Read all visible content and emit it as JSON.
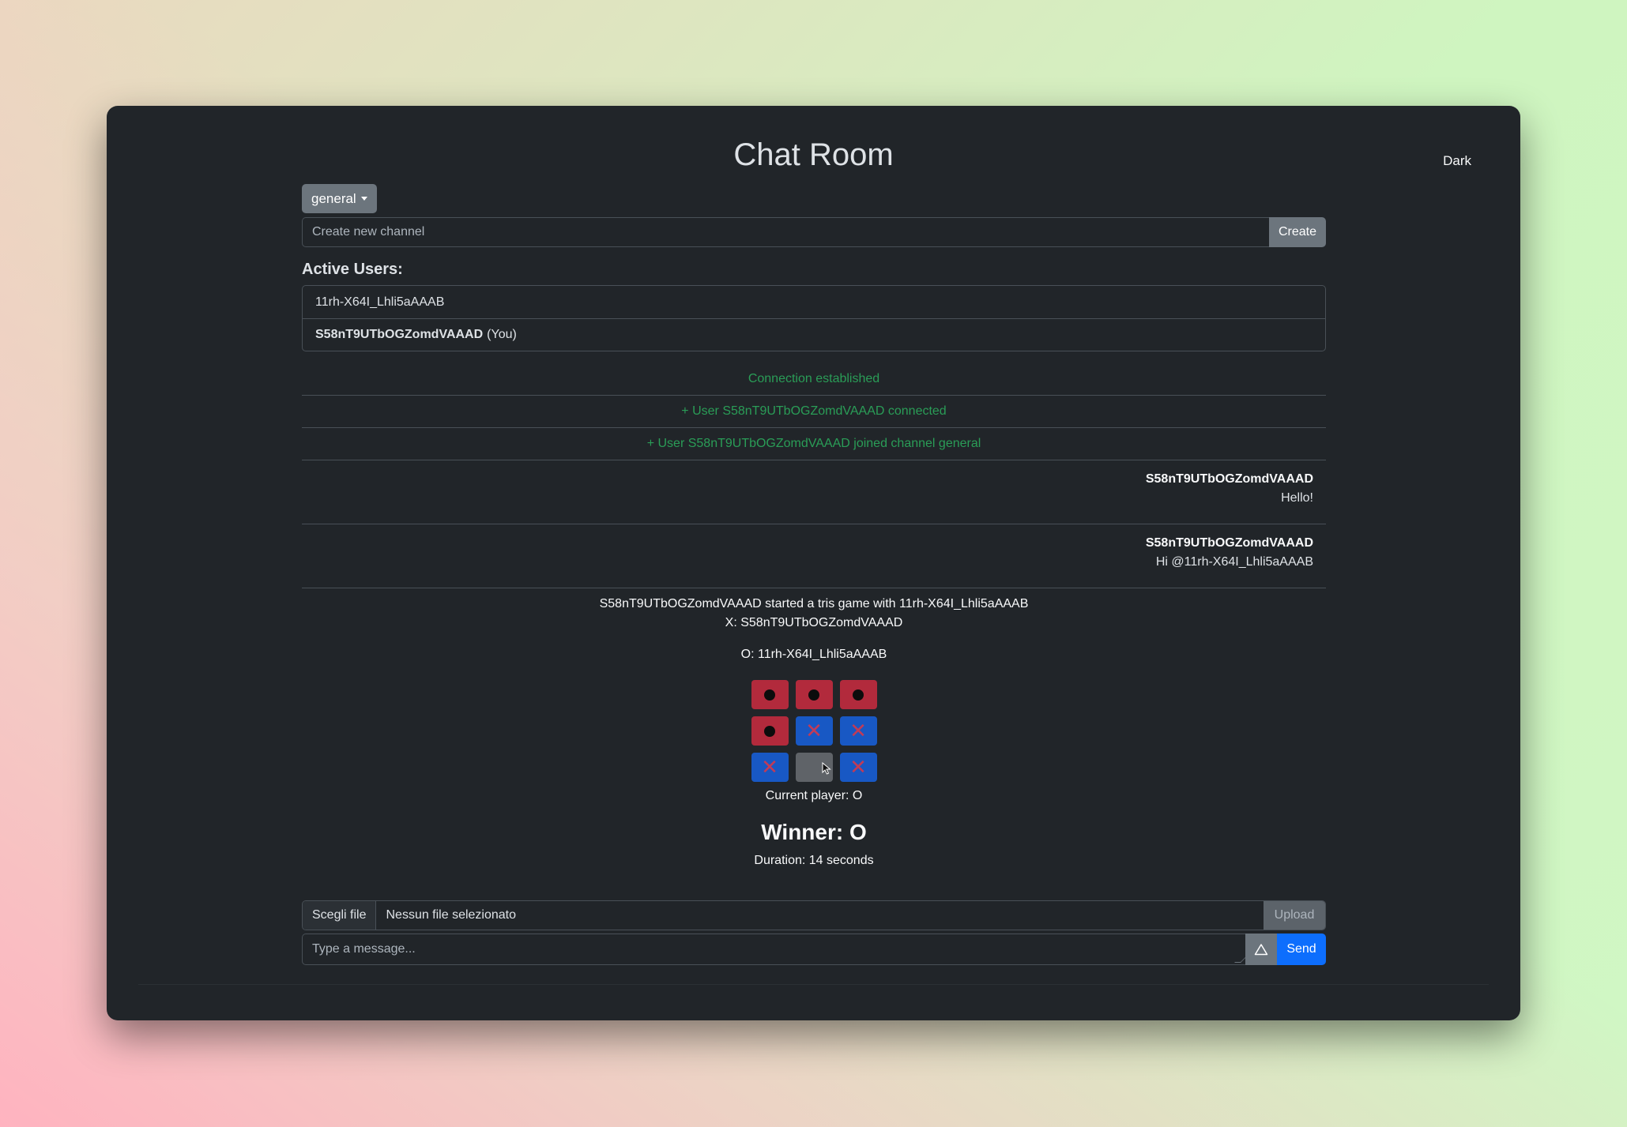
{
  "app": {
    "title": "Chat Room",
    "theme_toggle": "Dark"
  },
  "channel": {
    "selected": "general",
    "new_channel_placeholder": "Create new channel",
    "create_label": "Create"
  },
  "users": {
    "heading": "Active Users:",
    "list": [
      {
        "name": "11rh-X64I_Lhli5aAAAB",
        "you_suffix": ""
      },
      {
        "name": "S58nT9UTbOGZomdVAAAD",
        "you_suffix": "(You)"
      }
    ]
  },
  "messages": {
    "system": [
      "Connection established",
      "+ User S58nT9UTbOGZomdVAAAD connected",
      "+ User S58nT9UTbOGZomdVAAAD joined channel general"
    ],
    "chat": [
      {
        "author": "S58nT9UTbOGZomdVAAAD",
        "text": "Hello!"
      },
      {
        "author": "S58nT9UTbOGZomdVAAAD",
        "text": "Hi @11rh-X64I_Lhli5aAAAB"
      }
    ]
  },
  "game": {
    "started": "S58nT9UTbOGZomdVAAAD started a tris game with 11rh-X64I_Lhli5aAAAB",
    "player_x": "X: S58nT9UTbOGZomdVAAAD",
    "player_o": "O: 11rh-X64I_Lhli5aAAAB",
    "board": [
      "O",
      "O",
      "O",
      "O",
      "X",
      "X",
      "X",
      "",
      "X"
    ],
    "current_player": "Current player: O",
    "winner": "Winner: O",
    "duration": "Duration: 14 seconds",
    "colors": {
      "o_cell": "#b22a3c",
      "x_cell": "#1858c4",
      "empty_cell": "#5f6368"
    }
  },
  "composer": {
    "choose_file": "Scegli file",
    "no_file": "Nessun file selezionato",
    "upload_label": "Upload",
    "message_placeholder": "Type a message...",
    "emoji_icon": "triangle-icon",
    "send_label": "Send"
  },
  "colors": {
    "background": "#212529",
    "system_text": "#2a9d57",
    "primary": "#0d6efd",
    "secondary": "#6c757d"
  }
}
